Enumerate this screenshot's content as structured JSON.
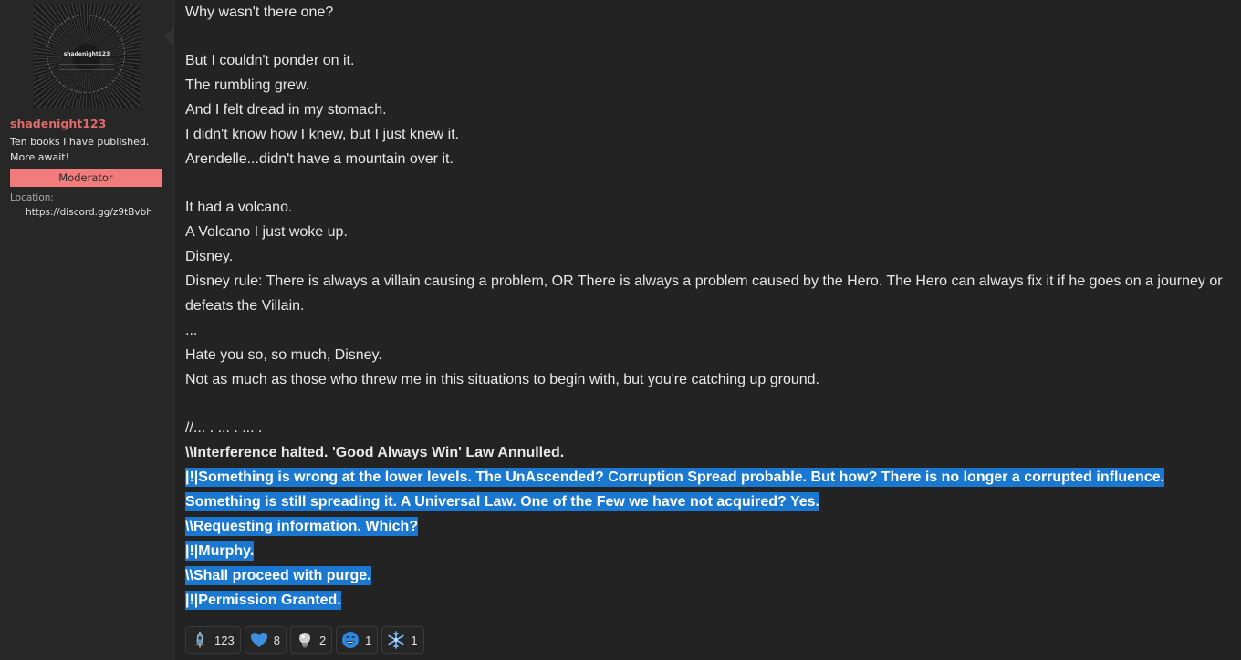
{
  "user": {
    "avatar_text": "shadenight123",
    "username": "shadenight123",
    "title_line1": "Ten books I have published.",
    "title_line2": "More await!",
    "banner": "Moderator",
    "location_label": "Location:",
    "location_value": "https://discord.gg/z9tBvbh"
  },
  "post": {
    "lines": [
      "Why wasn't there one?",
      "",
      "But I couldn't ponder on it.",
      "The rumbling grew.",
      "And I felt dread in my stomach.",
      "I didn't know how I knew, but I just knew it.",
      "Arendelle...didn't have a mountain over it.",
      "",
      "It had a volcano.",
      "A Volcano I just woke up.",
      "Disney.",
      "Disney rule: There is always a villain causing a problem, OR There is always a problem caused by the Hero. The Hero can always fix it if he goes on a journey or defeats the Villain.",
      "...",
      "Hate you so, so much, Disney.",
      "Not as much as those who threw me in this situations to begin with, but you're catching up ground.",
      "",
      "//... . ... . ... .",
      "\\\\Interference halted. 'Good Always Win' Law Annulled.",
      "|!|Something is wrong at the lower levels. The UnAscended? Corruption Spread probable. But how? There is no longer a corrupted influence.",
      "Something is still spreading it. A Universal Law. One of the Few we have not acquired? Yes.",
      "\\\\Requesting information. Which?",
      "|!|Murphy.",
      "\\\\Shall proceed with purge.",
      "|!|Permission Granted."
    ]
  },
  "reactions": [
    {
      "icon": "rocket-icon",
      "count": "123"
    },
    {
      "icon": "heart-icon",
      "count": "8"
    },
    {
      "icon": "lightbulb-icon",
      "count": "2"
    },
    {
      "icon": "laughing-face-icon",
      "count": "1"
    },
    {
      "icon": "snowflake-icon",
      "count": "1"
    }
  ],
  "colors": {
    "background": "#232323",
    "username": "#e06a6a",
    "moderator_banner": "#f27b7b",
    "selection_highlight": "#1b78d0"
  }
}
